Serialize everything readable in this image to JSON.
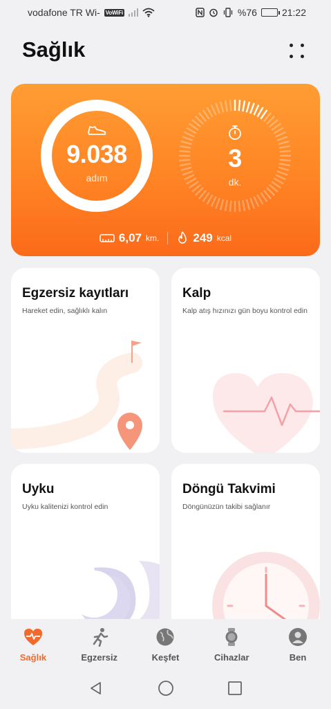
{
  "status_bar": {
    "carrier": "vodafone TR Wi-",
    "vowifi": "VoWiFi",
    "battery": "%76",
    "time": "21:22",
    "battery_level": 0.76
  },
  "header": {
    "title": "Sağlık"
  },
  "activity": {
    "steps": "9.038",
    "steps_unit": "adım",
    "exercise": "3",
    "exercise_unit": "dk.",
    "distance": "6,07",
    "distance_unit": "km.",
    "calories": "249",
    "calories_unit": "kcal",
    "steps_progress": 1.0,
    "exercise_progress": 0.1
  },
  "cards": [
    {
      "title": "Egzersiz kayıtları",
      "subtitle": "Hareket edin, sağlıklı kalın"
    },
    {
      "title": "Kalp",
      "subtitle": "Kalp atış hızınızı gün boyu kontrol edin"
    },
    {
      "title": "Uyku",
      "subtitle": "Uyku kalitenizi kontrol edin"
    },
    {
      "title": "Döngü Takvimi",
      "subtitle": "Döngünüzün takibi sağlanır"
    }
  ],
  "nav": [
    {
      "label": "Sağlık",
      "icon": "heart-pulse-icon",
      "active": true
    },
    {
      "label": "Egzersiz",
      "icon": "running-icon"
    },
    {
      "label": "Keşfet",
      "icon": "globe-icon"
    },
    {
      "label": "Cihazlar",
      "icon": "watch-icon"
    },
    {
      "label": "Ben",
      "icon": "person-icon"
    }
  ],
  "colors": {
    "accent": "#f26a2b",
    "card_gradient_top": "#ff9d33",
    "card_gradient_bottom": "#fb6a1a",
    "background": "#f1f1f3"
  }
}
